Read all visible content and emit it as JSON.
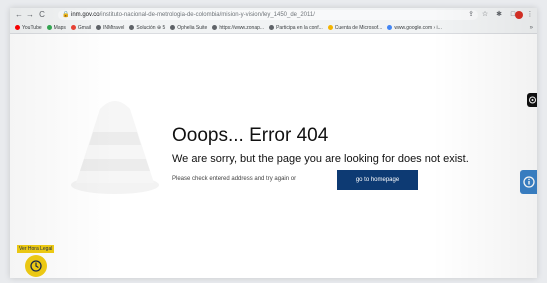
{
  "browser": {
    "url_host": "inm.gov.co",
    "url_path": "/instituto-nacional-de-metrologia-de-colombia/mision-y-vision/ley_1450_de_2011/",
    "bookmarks": [
      {
        "label": "YouTube",
        "color": "#ff0000"
      },
      {
        "label": "Maps",
        "color": "#34a853"
      },
      {
        "label": "Gmail",
        "color": "#ea4335"
      },
      {
        "label": "INMtravel",
        "color": "#5f6368"
      },
      {
        "label": "Solución ⊕ 5",
        "color": "#5f6368"
      },
      {
        "label": "Ophelia Suite",
        "color": "#5f6368"
      },
      {
        "label": "https://www.zonap...",
        "color": "#5f6368"
      },
      {
        "label": "Participa en la conf...",
        "color": "#5f6368"
      },
      {
        "label": "Cuenta de Microsof...",
        "color": "#f4b400"
      },
      {
        "label": "www.google.com › i...",
        "color": "#4285f4"
      }
    ]
  },
  "error_page": {
    "title": "Ooops... Error 404",
    "message": "We are sorry, but the page you are looking for does not exist.",
    "hint": "Please check entered address and try again or",
    "button_label": "go to homepage"
  },
  "floating": {
    "hora_label": "Ver Hora Legal"
  },
  "colors": {
    "primary_button": "#0d3a73",
    "accent_yellow": "#f2ce14",
    "side_widget_blue": "#3a82c8"
  }
}
